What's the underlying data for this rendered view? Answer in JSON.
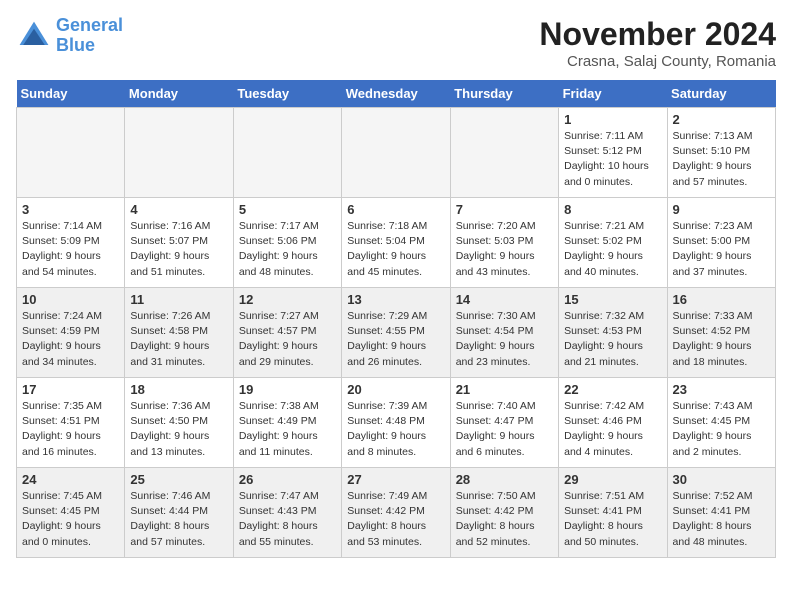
{
  "header": {
    "logo_line1": "General",
    "logo_line2": "Blue",
    "month": "November 2024",
    "location": "Crasna, Salaj County, Romania"
  },
  "weekdays": [
    "Sunday",
    "Monday",
    "Tuesday",
    "Wednesday",
    "Thursday",
    "Friday",
    "Saturday"
  ],
  "weeks": [
    [
      {
        "day": "",
        "info": "",
        "empty": true
      },
      {
        "day": "",
        "info": "",
        "empty": true
      },
      {
        "day": "",
        "info": "",
        "empty": true
      },
      {
        "day": "",
        "info": "",
        "empty": true
      },
      {
        "day": "",
        "info": "",
        "empty": true
      },
      {
        "day": "1",
        "info": "Sunrise: 7:11 AM\nSunset: 5:12 PM\nDaylight: 10 hours\nand 0 minutes.",
        "empty": false
      },
      {
        "day": "2",
        "info": "Sunrise: 7:13 AM\nSunset: 5:10 PM\nDaylight: 9 hours\nand 57 minutes.",
        "empty": false
      }
    ],
    [
      {
        "day": "3",
        "info": "Sunrise: 7:14 AM\nSunset: 5:09 PM\nDaylight: 9 hours\nand 54 minutes.",
        "empty": false
      },
      {
        "day": "4",
        "info": "Sunrise: 7:16 AM\nSunset: 5:07 PM\nDaylight: 9 hours\nand 51 minutes.",
        "empty": false
      },
      {
        "day": "5",
        "info": "Sunrise: 7:17 AM\nSunset: 5:06 PM\nDaylight: 9 hours\nand 48 minutes.",
        "empty": false
      },
      {
        "day": "6",
        "info": "Sunrise: 7:18 AM\nSunset: 5:04 PM\nDaylight: 9 hours\nand 45 minutes.",
        "empty": false
      },
      {
        "day": "7",
        "info": "Sunrise: 7:20 AM\nSunset: 5:03 PM\nDaylight: 9 hours\nand 43 minutes.",
        "empty": false
      },
      {
        "day": "8",
        "info": "Sunrise: 7:21 AM\nSunset: 5:02 PM\nDaylight: 9 hours\nand 40 minutes.",
        "empty": false
      },
      {
        "day": "9",
        "info": "Sunrise: 7:23 AM\nSunset: 5:00 PM\nDaylight: 9 hours\nand 37 minutes.",
        "empty": false
      }
    ],
    [
      {
        "day": "10",
        "info": "Sunrise: 7:24 AM\nSunset: 4:59 PM\nDaylight: 9 hours\nand 34 minutes.",
        "empty": false
      },
      {
        "day": "11",
        "info": "Sunrise: 7:26 AM\nSunset: 4:58 PM\nDaylight: 9 hours\nand 31 minutes.",
        "empty": false
      },
      {
        "day": "12",
        "info": "Sunrise: 7:27 AM\nSunset: 4:57 PM\nDaylight: 9 hours\nand 29 minutes.",
        "empty": false
      },
      {
        "day": "13",
        "info": "Sunrise: 7:29 AM\nSunset: 4:55 PM\nDaylight: 9 hours\nand 26 minutes.",
        "empty": false
      },
      {
        "day": "14",
        "info": "Sunrise: 7:30 AM\nSunset: 4:54 PM\nDaylight: 9 hours\nand 23 minutes.",
        "empty": false
      },
      {
        "day": "15",
        "info": "Sunrise: 7:32 AM\nSunset: 4:53 PM\nDaylight: 9 hours\nand 21 minutes.",
        "empty": false
      },
      {
        "day": "16",
        "info": "Sunrise: 7:33 AM\nSunset: 4:52 PM\nDaylight: 9 hours\nand 18 minutes.",
        "empty": false
      }
    ],
    [
      {
        "day": "17",
        "info": "Sunrise: 7:35 AM\nSunset: 4:51 PM\nDaylight: 9 hours\nand 16 minutes.",
        "empty": false
      },
      {
        "day": "18",
        "info": "Sunrise: 7:36 AM\nSunset: 4:50 PM\nDaylight: 9 hours\nand 13 minutes.",
        "empty": false
      },
      {
        "day": "19",
        "info": "Sunrise: 7:38 AM\nSunset: 4:49 PM\nDaylight: 9 hours\nand 11 minutes.",
        "empty": false
      },
      {
        "day": "20",
        "info": "Sunrise: 7:39 AM\nSunset: 4:48 PM\nDaylight: 9 hours\nand 8 minutes.",
        "empty": false
      },
      {
        "day": "21",
        "info": "Sunrise: 7:40 AM\nSunset: 4:47 PM\nDaylight: 9 hours\nand 6 minutes.",
        "empty": false
      },
      {
        "day": "22",
        "info": "Sunrise: 7:42 AM\nSunset: 4:46 PM\nDaylight: 9 hours\nand 4 minutes.",
        "empty": false
      },
      {
        "day": "23",
        "info": "Sunrise: 7:43 AM\nSunset: 4:45 PM\nDaylight: 9 hours\nand 2 minutes.",
        "empty": false
      }
    ],
    [
      {
        "day": "24",
        "info": "Sunrise: 7:45 AM\nSunset: 4:45 PM\nDaylight: 9 hours\nand 0 minutes.",
        "empty": false
      },
      {
        "day": "25",
        "info": "Sunrise: 7:46 AM\nSunset: 4:44 PM\nDaylight: 8 hours\nand 57 minutes.",
        "empty": false
      },
      {
        "day": "26",
        "info": "Sunrise: 7:47 AM\nSunset: 4:43 PM\nDaylight: 8 hours\nand 55 minutes.",
        "empty": false
      },
      {
        "day": "27",
        "info": "Sunrise: 7:49 AM\nSunset: 4:42 PM\nDaylight: 8 hours\nand 53 minutes.",
        "empty": false
      },
      {
        "day": "28",
        "info": "Sunrise: 7:50 AM\nSunset: 4:42 PM\nDaylight: 8 hours\nand 52 minutes.",
        "empty": false
      },
      {
        "day": "29",
        "info": "Sunrise: 7:51 AM\nSunset: 4:41 PM\nDaylight: 8 hours\nand 50 minutes.",
        "empty": false
      },
      {
        "day": "30",
        "info": "Sunrise: 7:52 AM\nSunset: 4:41 PM\nDaylight: 8 hours\nand 48 minutes.",
        "empty": false
      }
    ]
  ]
}
